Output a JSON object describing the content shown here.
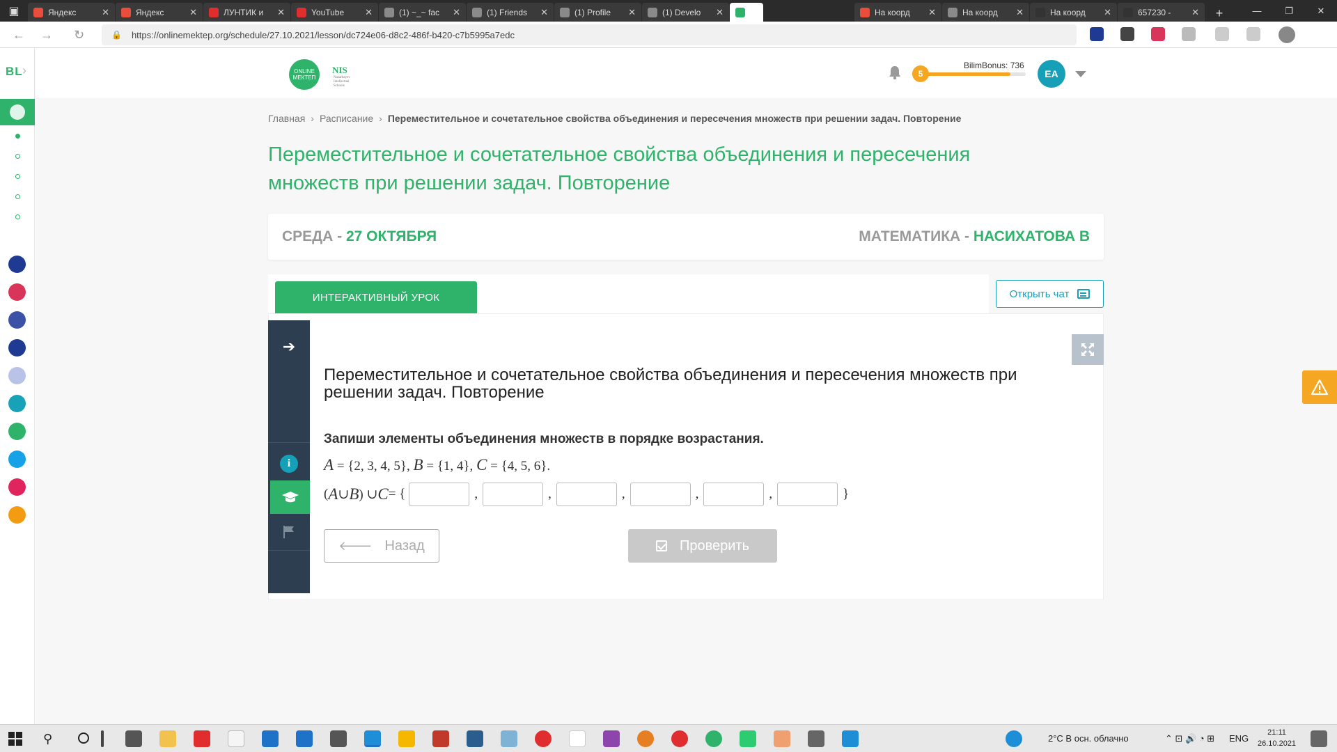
{
  "browser": {
    "tabs": [
      {
        "label": "Яндекс",
        "color": "#e94e3c"
      },
      {
        "label": "Яндекс",
        "color": "#e94e3c"
      },
      {
        "label": "ЛУНТИК и",
        "color": "#e02d2d"
      },
      {
        "label": "YouTube",
        "color": "#e02d2d"
      },
      {
        "label": "(1) ~_~ fac",
        "color": "#8a8a8a"
      },
      {
        "label": "(1) Friends",
        "color": "#8a8a8a"
      },
      {
        "label": "(1) Profile",
        "color": "#8a8a8a"
      },
      {
        "label": "(1) Develo",
        "color": "#8a8a8a"
      },
      {
        "label": "",
        "color": "#2fb36b"
      },
      {
        "label": "На коорд",
        "color": "#e94e3c"
      },
      {
        "label": "На коорд",
        "color": "#8a8a8a"
      },
      {
        "label": "На коорд",
        "color": "#333333"
      },
      {
        "label": "657230 -",
        "color": "#333333"
      }
    ],
    "url": "https://onlinemektep.org/schedule/27.10.2021/lesson/dc724e06-d8c2-486f-b420-c7b5995a7edc"
  },
  "header": {
    "om_logo": "ONLINE МЕКТЕП",
    "nis_logo": "NIS",
    "nis_sub": "Nazarbayev Intellectual Schools",
    "level": "5",
    "bonus_label": "BilimBonus: 736",
    "bonus_progress": 0.85,
    "avatar_initials": "EA"
  },
  "sidebar": {
    "logo": "BL",
    "apps": [
      "#1f3a93",
      "#d9345a",
      "#3b52a6",
      "#1f3a93",
      "#b9c3e8",
      "#17a2b8",
      "#2fb36b",
      "#17a2e8",
      "#e0245e",
      "#f39c12"
    ]
  },
  "breadcrumb": {
    "home": "Главная",
    "schedule": "Расписание",
    "current": "Переместительное и сочетательное свойства объединения и пересечения множеств при решении задач. Повторение"
  },
  "page": {
    "title": "Переместительное и сочетательное свойства объединения и пересечения множеств при решении задач. Повторение"
  },
  "date_card": {
    "day": "СРЕДА - ",
    "date": "27 ОКТЯБРЯ",
    "subject": "МАТЕМАТИКА - ",
    "teacher": "НАСИХАТОВА В"
  },
  "lesson": {
    "tab_label": "ИНТЕРАКТИВНЫЙ УРОК",
    "chat_label": "Открыть чат",
    "task_title": "Переместительное и сочетательное свойства объединения и пересечения множеств при решении задач. Повторение",
    "instruction": "Запиши элементы объединения множеств в порядке возрастания.",
    "setA_name": "A",
    "setA_vals": " = {2, 3, 4, 5}, ",
    "setB_name": "B",
    "setB_vals": " = {1, 4}, ",
    "setC_name": "C",
    "setC_vals": " = {4, 5, 6}.",
    "eq_open": "(",
    "eq_A": "A",
    "eq_union1": " ∪ ",
    "eq_B": "B",
    "eq_close": ") ∪ ",
    "eq_C": "C",
    "eq_equals": " = {",
    "eq_end": "}",
    "answers": [
      "",
      "",
      "",
      "",
      "",
      ""
    ],
    "back_label": "Назад",
    "check_label": "Проверить"
  },
  "taskbar": {
    "weather": "2°C  В осн. облачно",
    "lang": "ENG",
    "time": "21:11",
    "date": "26.10.2021"
  },
  "colors": {
    "accent": "#2fb36b",
    "teal": "#16a0b8",
    "orange": "#f5a623",
    "dark_panel": "#2c3e50"
  }
}
